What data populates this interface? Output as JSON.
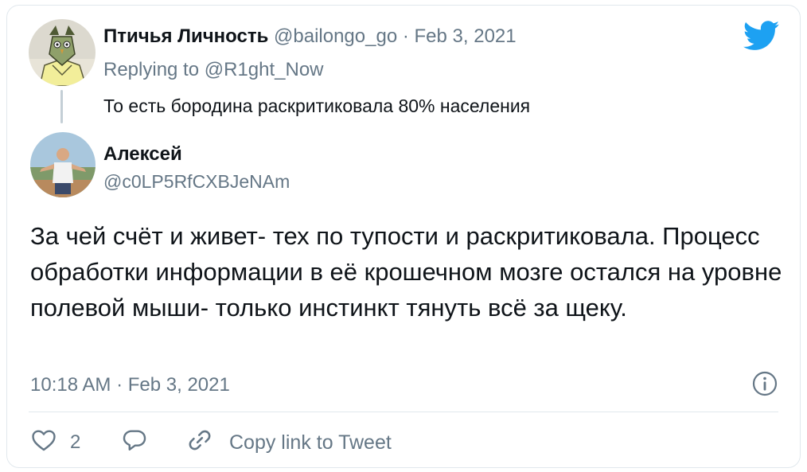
{
  "parent_tweet": {
    "display_name": "Птичья Личность",
    "handle": "@bailongo_go",
    "separator": "·",
    "date": "Feb 3, 2021",
    "replying_prefix": "Replying to ",
    "replying_to": "@R1ght_Now",
    "text": "То есть бородина раскритиковала 80% населения",
    "avatar_icon": "owl-avatar"
  },
  "reply_tweet": {
    "display_name": "Алексей",
    "handle": "@c0LP5RfCXBJeNAm",
    "text": "За чей счёт и живет- тех по тупости и раскритиковала. Процесс обработки информации в её крошечном мозге остался на уровне полевой мыши- только инстинкт тянуть всё за щеку.",
    "timestamp": "10:18 AM · Feb 3, 2021",
    "avatar_icon": "person-avatar"
  },
  "actions": {
    "like_count": "2",
    "copy_link_label": "Copy link to Tweet"
  },
  "icons": {
    "brand": "twitter-bird-icon",
    "info": "info-icon",
    "like": "heart-icon",
    "reply": "reply-bubble-icon",
    "copy": "link-icon"
  },
  "colors": {
    "brand": "#1da1f2",
    "muted": "#657786",
    "text": "#0f1419",
    "border": "#e1e8ed"
  }
}
